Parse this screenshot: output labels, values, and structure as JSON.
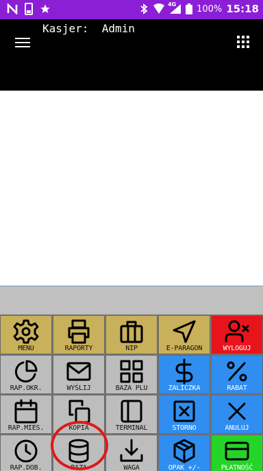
{
  "status_bar": {
    "left_icons": [
      "n-icon",
      "sim-card-icon",
      "star-icon"
    ],
    "battery": "100%",
    "network": "4G",
    "time": "15:18",
    "background": "#8a1fd6"
  },
  "header": {
    "cashier_label": "Kasjer:",
    "cashier_name": "Admin",
    "background": "#000000"
  },
  "keypad": {
    "rows": [
      [
        {
          "label": "MENU",
          "icon": "gear-icon",
          "color": "gold"
        },
        {
          "label": "RAPORTY",
          "icon": "printer-icon",
          "color": "gold"
        },
        {
          "label": "NIP",
          "icon": "briefcase-icon",
          "color": "gold"
        },
        {
          "label": "E-PARAGON",
          "icon": "send-icon",
          "color": "gold"
        },
        {
          "label": "WYLOGUJ",
          "icon": "user-remove-icon",
          "color": "red"
        }
      ],
      [
        {
          "label": "RAP.OKR.",
          "icon": "pie-chart-icon",
          "color": "gray"
        },
        {
          "label": "WYŚLIJ",
          "icon": "envelope-icon",
          "color": "gray"
        },
        {
          "label": "BAZA PLU",
          "icon": "grid-icon",
          "color": "gray"
        },
        {
          "label": "ZALICZKA",
          "icon": "dollar-icon",
          "color": "blue"
        },
        {
          "label": "RABAT",
          "icon": "percent-icon",
          "color": "blue"
        }
      ],
      [
        {
          "label": "RAP.MIES.",
          "icon": "calendar-icon",
          "color": "gray"
        },
        {
          "label": "KOPIA",
          "icon": "copy-icon",
          "color": "gray"
        },
        {
          "label": "TERMINAL",
          "icon": "terminal-icon",
          "color": "gray"
        },
        {
          "label": "STORNO",
          "icon": "cancel-box-icon",
          "color": "blue"
        },
        {
          "label": "ANULUJ",
          "icon": "close-icon",
          "color": "blue"
        }
      ],
      [
        {
          "label": "RAP.DOB.",
          "icon": "clock-icon",
          "color": "gray"
        },
        {
          "label": "BAZA",
          "icon": "database-icon",
          "color": "gray"
        },
        {
          "label": "WAGA",
          "icon": "download-icon",
          "color": "gray"
        },
        {
          "label": "OPAK +/-",
          "icon": "package-icon",
          "color": "blue"
        },
        {
          "label": "PŁATNOŚĆ",
          "icon": "card-icon",
          "color": "green"
        }
      ]
    ]
  },
  "colors": {
    "gold": "#c9b05a",
    "gray": "#bdbdbd",
    "blue": "#2f8ef0",
    "red": "#e8141c",
    "green": "#25d428",
    "highlight": "#e01818"
  }
}
